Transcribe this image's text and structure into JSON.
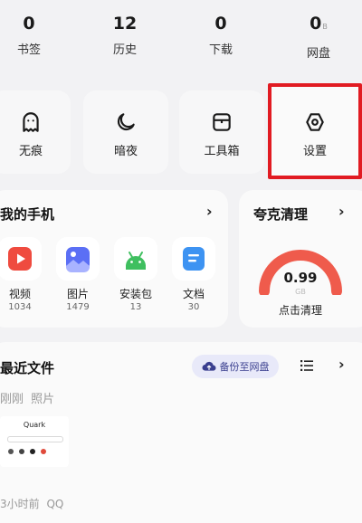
{
  "stats": [
    {
      "value": "0",
      "unit": "",
      "label": "书签"
    },
    {
      "value": "12",
      "unit": "",
      "label": "历史"
    },
    {
      "value": "0",
      "unit": "",
      "label": "下载"
    },
    {
      "value": "0",
      "unit": "B",
      "label": "网盘"
    }
  ],
  "tiles": [
    {
      "label": "无痕",
      "icon": "ghost-icon"
    },
    {
      "label": "暗夜",
      "icon": "moon-icon"
    },
    {
      "label": "工具箱",
      "icon": "toolbox-icon"
    },
    {
      "label": "设置",
      "icon": "settings-hexagon-icon"
    }
  ],
  "phone": {
    "title": "我的手机",
    "apps": [
      {
        "name": "视频",
        "count": "1034",
        "icon": "video-play-icon",
        "color": "#ef4b3f"
      },
      {
        "name": "图片",
        "count": "1479",
        "icon": "image-icon",
        "color": "#5b6ff5"
      },
      {
        "name": "安装包",
        "count": "13",
        "icon": "android-icon",
        "color": "#3fbf5f"
      },
      {
        "name": "文档",
        "count": "30",
        "icon": "document-icon",
        "color": "#3d93f2"
      }
    ]
  },
  "cleaner": {
    "title": "夸克清理",
    "value": "0.99",
    "unit": "GB",
    "action": "点击清理",
    "gauge_color": "#ef5b4c"
  },
  "recent": {
    "title": "最近文件",
    "backup_label": "备份至网盘",
    "group_time": "刚刚",
    "group_type": "照片",
    "thumb_brand": "Quark",
    "footer_time": "3小时前",
    "footer_app": "QQ"
  }
}
